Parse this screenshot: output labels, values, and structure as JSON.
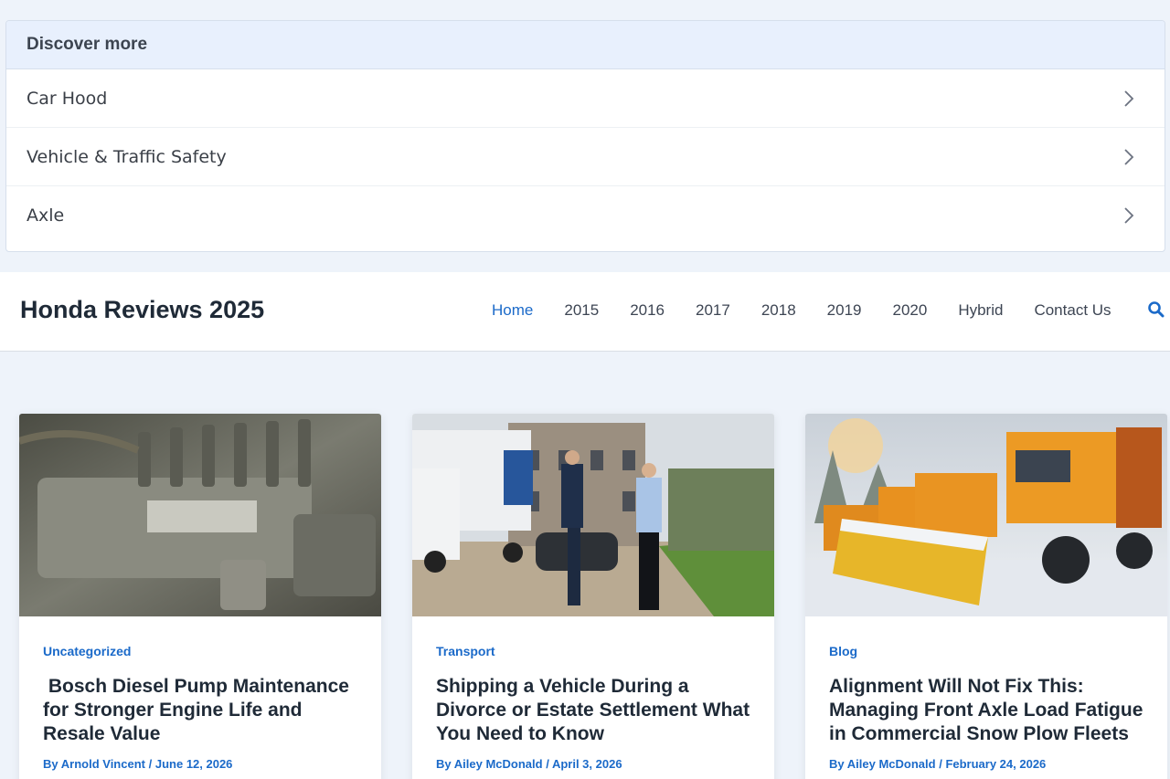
{
  "discover": {
    "heading": "Discover more",
    "items": [
      {
        "label": "Car Hood"
      },
      {
        "label": "Vehicle & Traffic Safety"
      },
      {
        "label": "Axle"
      }
    ]
  },
  "header": {
    "site_title": "Honda Reviews 2025",
    "nav": [
      "Home",
      "2015",
      "2016",
      "2017",
      "2018",
      "2019",
      "2020",
      "Hybrid",
      "Contact Us"
    ],
    "search_icon": "search-icon"
  },
  "posts": [
    {
      "category": "Uncategorized",
      "title": " Bosch Diesel Pump Maintenance for Stronger Engine Life and Resale Value",
      "by": "By",
      "author": "Arnold Vincent",
      "separator": "/",
      "date": "June 12, 2026"
    },
    {
      "category": "Transport",
      "title": "Shipping a Vehicle During a Divorce or Estate Settlement What You Need to Know",
      "by": "By",
      "author": "Ailey McDonald",
      "separator": "/",
      "date": "April 3, 2026"
    },
    {
      "category": "Blog",
      "title": "Alignment Will Not Fix This: Managing Front Axle Load Fatigue in Commercial Snow Plow Fleets",
      "by": "By",
      "author": "Ailey McDonald",
      "separator": "/",
      "date": "February 24, 2026"
    }
  ],
  "colors": {
    "accent": "#1b6ac9",
    "page_background": "#eef3fa",
    "discover_header": "#e8f0fd"
  }
}
